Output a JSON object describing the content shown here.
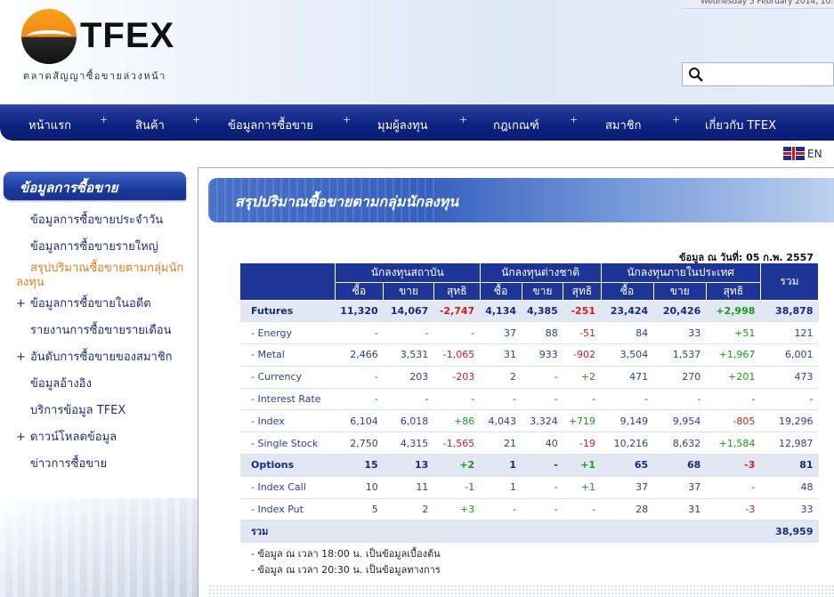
{
  "header": {
    "logo_text": "TFEX",
    "logo_subtitle": "ตลาดสัญญาซื้อขายล่วงหน้า",
    "date_text": "Wednesday 5 February 2014, 10:",
    "search_placeholder": ""
  },
  "nav": {
    "items": [
      "หน้าแรก",
      "สินค้า",
      "ข้อมูลการซื้อขาย",
      "มุมผู้ลงทุน",
      "กฎเกณฑ์",
      "สมาชิก",
      "เกี่ยวกับ TFEX"
    ],
    "separator": "+"
  },
  "language": {
    "label": "EN"
  },
  "sidebar": {
    "title": "ข้อมูลการซื้อขาย",
    "items": [
      {
        "label": "ข้อมูลการซื้อขายประจำวัน",
        "prefix": ""
      },
      {
        "label": "ข้อมูลการซื้อขายรายใหญ่",
        "prefix": ""
      },
      {
        "label": "สรุปปริมาณซื้อขายตามกลุ่มนักลงทุน",
        "prefix": ""
      },
      {
        "label": "ข้อมูลการซื้อขายในอดีต",
        "prefix": "+"
      },
      {
        "label": "รายงานการซื้อขายรายเดือน",
        "prefix": ""
      },
      {
        "label": "อันดับการซื้อขายของสมาชิก",
        "prefix": "+"
      },
      {
        "label": "ข้อมูลอ้างอิง",
        "prefix": ""
      },
      {
        "label": "บริการข้อมูล TFEX",
        "prefix": ""
      },
      {
        "label": "ดาวน์โหลดข้อมูล",
        "prefix": "+"
      },
      {
        "label": "ข่าวการซื้อขาย",
        "prefix": ""
      }
    ]
  },
  "main": {
    "banner_title": "สรุปปริมาณซื้อขายตามกลุ่มนักลงทุน",
    "data_date": "ข้อมูล ณ วันที่: 05 ก.พ. 2557",
    "table": {
      "groups": [
        "นักลงทุนสถาบัน",
        "นักลงทุนต่างชาติ",
        "นักลงทุนภายในประเทศ",
        "รวม"
      ],
      "subheaders": [
        "ซื้อ",
        "ขาย",
        "สุทธิ",
        "ซื้อ",
        "ขาย",
        "สุทธิ",
        "ซื้อ",
        "ขาย",
        "สุทธิ"
      ],
      "rows": [
        {
          "type": "sec",
          "label": "Futures",
          "values": [
            "11,320",
            "14,067",
            "-2,747",
            "4,134",
            "4,385",
            "-251",
            "23,424",
            "20,426",
            "+2,998",
            "38,878"
          ]
        },
        {
          "type": "row",
          "label": "- Energy",
          "values": [
            "-",
            "-",
            "-",
            "37",
            "88",
            "-51",
            "84",
            "33",
            "+51",
            "121"
          ]
        },
        {
          "type": "row",
          "label": "- Metal",
          "values": [
            "2,466",
            "3,531",
            "-1,065",
            "31",
            "933",
            "-902",
            "3,504",
            "1,537",
            "+1,967",
            "6,001"
          ]
        },
        {
          "type": "row",
          "label": "- Currency",
          "values": [
            "-",
            "203",
            "-203",
            "2",
            "-",
            "+2",
            "471",
            "270",
            "+201",
            "473"
          ]
        },
        {
          "type": "row",
          "label": "- Interest Rate",
          "values": [
            "-",
            "-",
            "-",
            "-",
            "-",
            "-",
            "-",
            "-",
            "-",
            "-"
          ]
        },
        {
          "type": "row",
          "label": "- Index",
          "values": [
            "6,104",
            "6,018",
            "+86",
            "4,043",
            "3,324",
            "+719",
            "9,149",
            "9,954",
            "-805",
            "19,296"
          ]
        },
        {
          "type": "row",
          "label": "- Single Stock",
          "values": [
            "2,750",
            "4,315",
            "-1,565",
            "21",
            "40",
            "-19",
            "10,216",
            "8,632",
            "+1,584",
            "12,987"
          ]
        },
        {
          "type": "sec",
          "label": "Options",
          "values": [
            "15",
            "13",
            "+2",
            "1",
            "-",
            "+1",
            "65",
            "68",
            "-3",
            "81"
          ]
        },
        {
          "type": "row",
          "label": "- Index Call",
          "values": [
            "10",
            "11",
            "-1",
            "1",
            "-",
            "+1",
            "37",
            "37",
            "-",
            "48"
          ]
        },
        {
          "type": "row",
          "label": "- Index Put",
          "values": [
            "5",
            "2",
            "+3",
            "-",
            "-",
            "-",
            "28",
            "31",
            "-3",
            "33"
          ]
        },
        {
          "type": "total",
          "label": "รวม",
          "values": [
            "",
            "",
            "",
            "",
            "",
            "",
            "",
            "",
            "",
            "38,959"
          ]
        }
      ]
    },
    "notes": [
      "- ข้อมูล ณ เวลา 18:00 น. เป็นข้อมูลเบื้องต้น",
      "- ข้อมูล ณ เวลา 20:30 น. เป็นข้อมูลทางการ"
    ]
  },
  "colors": {
    "nav": "#0e2483",
    "header_cell": "#1d3596",
    "negative": "#d21b1b",
    "positive": "#1a9a1a",
    "active_link": "#e37b1c"
  }
}
